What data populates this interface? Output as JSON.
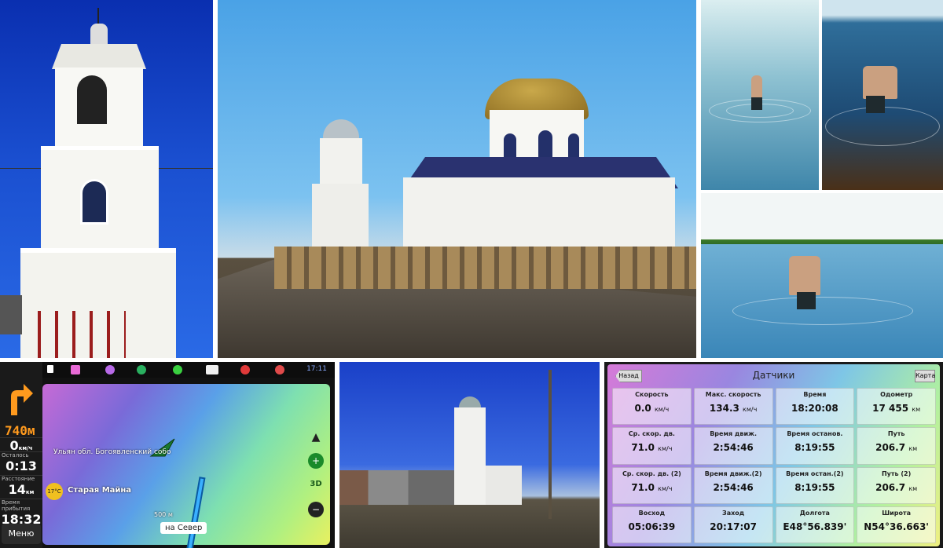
{
  "navigator": {
    "distance_to_turn": "740м",
    "speed": {
      "value": "0",
      "unit": "км/ч"
    },
    "remaining_time": {
      "label": "Осталось",
      "value": "0:13"
    },
    "remaining_distance": {
      "label": "Расстояние",
      "value": "14",
      "unit": "км"
    },
    "arrival_time": {
      "label": "Время прибытия",
      "value": "18:32"
    },
    "menu_label": "Меню",
    "clock": "17:11",
    "map": {
      "place_label": "Ульян обл. Богоявленский собо",
      "town_label": "Старая Майна",
      "temperature": "17°C",
      "scale": "500 м",
      "direction_chip": "на Север",
      "zoom_3d": "3D"
    }
  },
  "sensors": {
    "title": "Датчики",
    "back_label": "Назад",
    "map_label": "Карта",
    "cells": [
      {
        "label": "Скорость",
        "value": "0.0",
        "unit": "км/ч"
      },
      {
        "label": "Макс. скорость",
        "value": "134.3",
        "unit": "км/ч"
      },
      {
        "label": "Время",
        "value": "18:20:08",
        "unit": ""
      },
      {
        "label": "Одометр",
        "value": "17 455",
        "unit": "км"
      },
      {
        "label": "Ср. скор. дв.",
        "value": "71.0",
        "unit": "км/ч"
      },
      {
        "label": "Время движ.",
        "value": "2:54:46",
        "unit": ""
      },
      {
        "label": "Время останов.",
        "value": "8:19:55",
        "unit": ""
      },
      {
        "label": "Путь",
        "value": "206.7",
        "unit": "км"
      },
      {
        "label": "Ср. скор. дв. (2)",
        "value": "71.0",
        "unit": "км/ч"
      },
      {
        "label": "Время движ.(2)",
        "value": "2:54:46",
        "unit": ""
      },
      {
        "label": "Время остан.(2)",
        "value": "8:19:55",
        "unit": ""
      },
      {
        "label": "Путь (2)",
        "value": "206.7",
        "unit": "км"
      },
      {
        "label": "Восход",
        "value": "05:06:39",
        "unit": ""
      },
      {
        "label": "Заход",
        "value": "20:17:07",
        "unit": ""
      },
      {
        "label": "Долгота",
        "value": "E48°56.839'",
        "unit": ""
      },
      {
        "label": "Широта",
        "value": "N54°36.663'",
        "unit": ""
      }
    ]
  },
  "colors": {
    "nav_accent": "#ff9a1e",
    "sky_blue": "#1a4fd0"
  }
}
